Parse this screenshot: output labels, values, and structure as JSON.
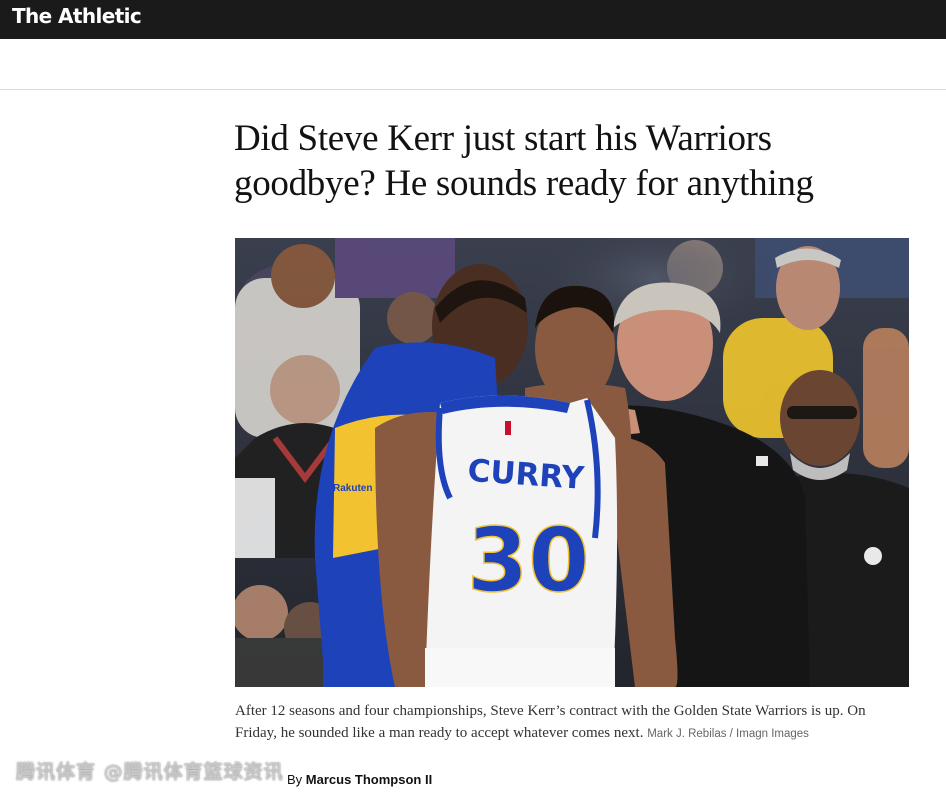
{
  "site": {
    "logo": "The Athletic"
  },
  "article": {
    "headline_line1": "Did Steve Kerr just start his Warriors",
    "headline_line2": "goodbye? He sounds ready for anything",
    "image": {
      "caption": "After 12 seasons and four championships, Steve Kerr’s contract with the Golden State Warriors is up. On Friday, he sounded like a man ready to accept whatever comes next.",
      "credit": "Mark J. Rebilas / Imagn Images",
      "jersey_name": "CURRY",
      "jersey_number": "30",
      "sleeve_sponsor": "Rakuten"
    },
    "byline": {
      "prefix": "By",
      "author": "Marcus Thompson II"
    }
  },
  "watermark": "腾讯体育 @腾讯体育篮球资讯",
  "colors": {
    "topbar": "#1a1a1a",
    "warriors_blue": "#1d42ba",
    "warriors_gold": "#f2c230",
    "fan_yellow": "#f1c62c"
  }
}
